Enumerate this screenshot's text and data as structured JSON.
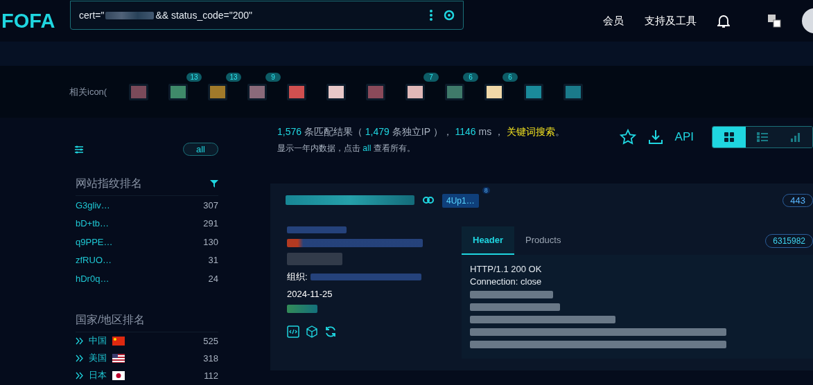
{
  "header": {
    "logo": "FOFA",
    "query_prefix": "cert=\"",
    "query_suffix": "&& status_code=\"200\"",
    "nav": [
      "会员",
      "支持及工具"
    ]
  },
  "related_icons": {
    "label": "相关icon(",
    "items": [
      {
        "color": "#7a4a5a"
      },
      {
        "count": "13",
        "color": "#3f8a6a"
      },
      {
        "count": "13",
        "color": "#a07a2a"
      },
      {
        "count": "9",
        "color": "#8a6a7a"
      },
      {
        "color": "#d05050"
      },
      {
        "color": "#e8c8c8"
      },
      {
        "color": "#8a4a5a"
      },
      {
        "count": "7",
        "color": "#e0b8b8"
      },
      {
        "count": "6",
        "color": "#3f7a6a"
      },
      {
        "count": "6",
        "color": "#f0d8a8"
      },
      {
        "color": "#1a8a9a"
      },
      {
        "color": "#1a7a8a"
      }
    ]
  },
  "sidebar": {
    "all_label": "all",
    "fingerprint": {
      "title": "网站指纹排名",
      "rows": [
        {
          "name": "G3gliv…",
          "count": "307"
        },
        {
          "name": "bD+tb…",
          "count": "291"
        },
        {
          "name": "q9PPE…",
          "count": "130"
        },
        {
          "name": "zfRUO…",
          "count": "31"
        },
        {
          "name": "hDr0q…",
          "count": "24"
        }
      ]
    },
    "countries": {
      "title": "国家/地区排名",
      "rows": [
        {
          "name": "中国",
          "kind": "cn",
          "count": "525"
        },
        {
          "name": "美国",
          "kind": "us",
          "count": "318"
        },
        {
          "name": "日本",
          "kind": "jp",
          "count": "112"
        }
      ]
    }
  },
  "summary": {
    "segments": [
      {
        "kind": "num",
        "text": "1,576"
      },
      {
        "kind": "text",
        "text": " 条匹配结果（ "
      },
      {
        "kind": "num",
        "text": "1,479"
      },
      {
        "kind": "text",
        "text": " 条独立IP ）， "
      },
      {
        "kind": "num",
        "text": "1146"
      },
      {
        "kind": "text",
        "text": " ms ， "
      },
      {
        "kind": "highlight",
        "text": "关键词搜索"
      },
      {
        "kind": "text",
        "text": "。"
      }
    ],
    "note_before": "显示一年内数据，点击 ",
    "note_link": "all",
    "note_after": " 查看所有。",
    "api": "API",
    "views": [
      {
        "kind": "grid",
        "selected": true
      },
      {
        "kind": "list",
        "selected": false
      },
      {
        "kind": "chart",
        "selected": false
      }
    ]
  },
  "result": {
    "tag": "4Up1…",
    "tag_count": "8",
    "port": "443",
    "org_label": "组织:",
    "date": "2024-11-25",
    "tabs": [
      {
        "label": "Header",
        "selected": true
      },
      {
        "label": "Products",
        "selected": false
      }
    ],
    "id_badge": "6315982",
    "header_lines": [
      "HTTP/1.1 200 OK",
      "Connection: close"
    ]
  }
}
